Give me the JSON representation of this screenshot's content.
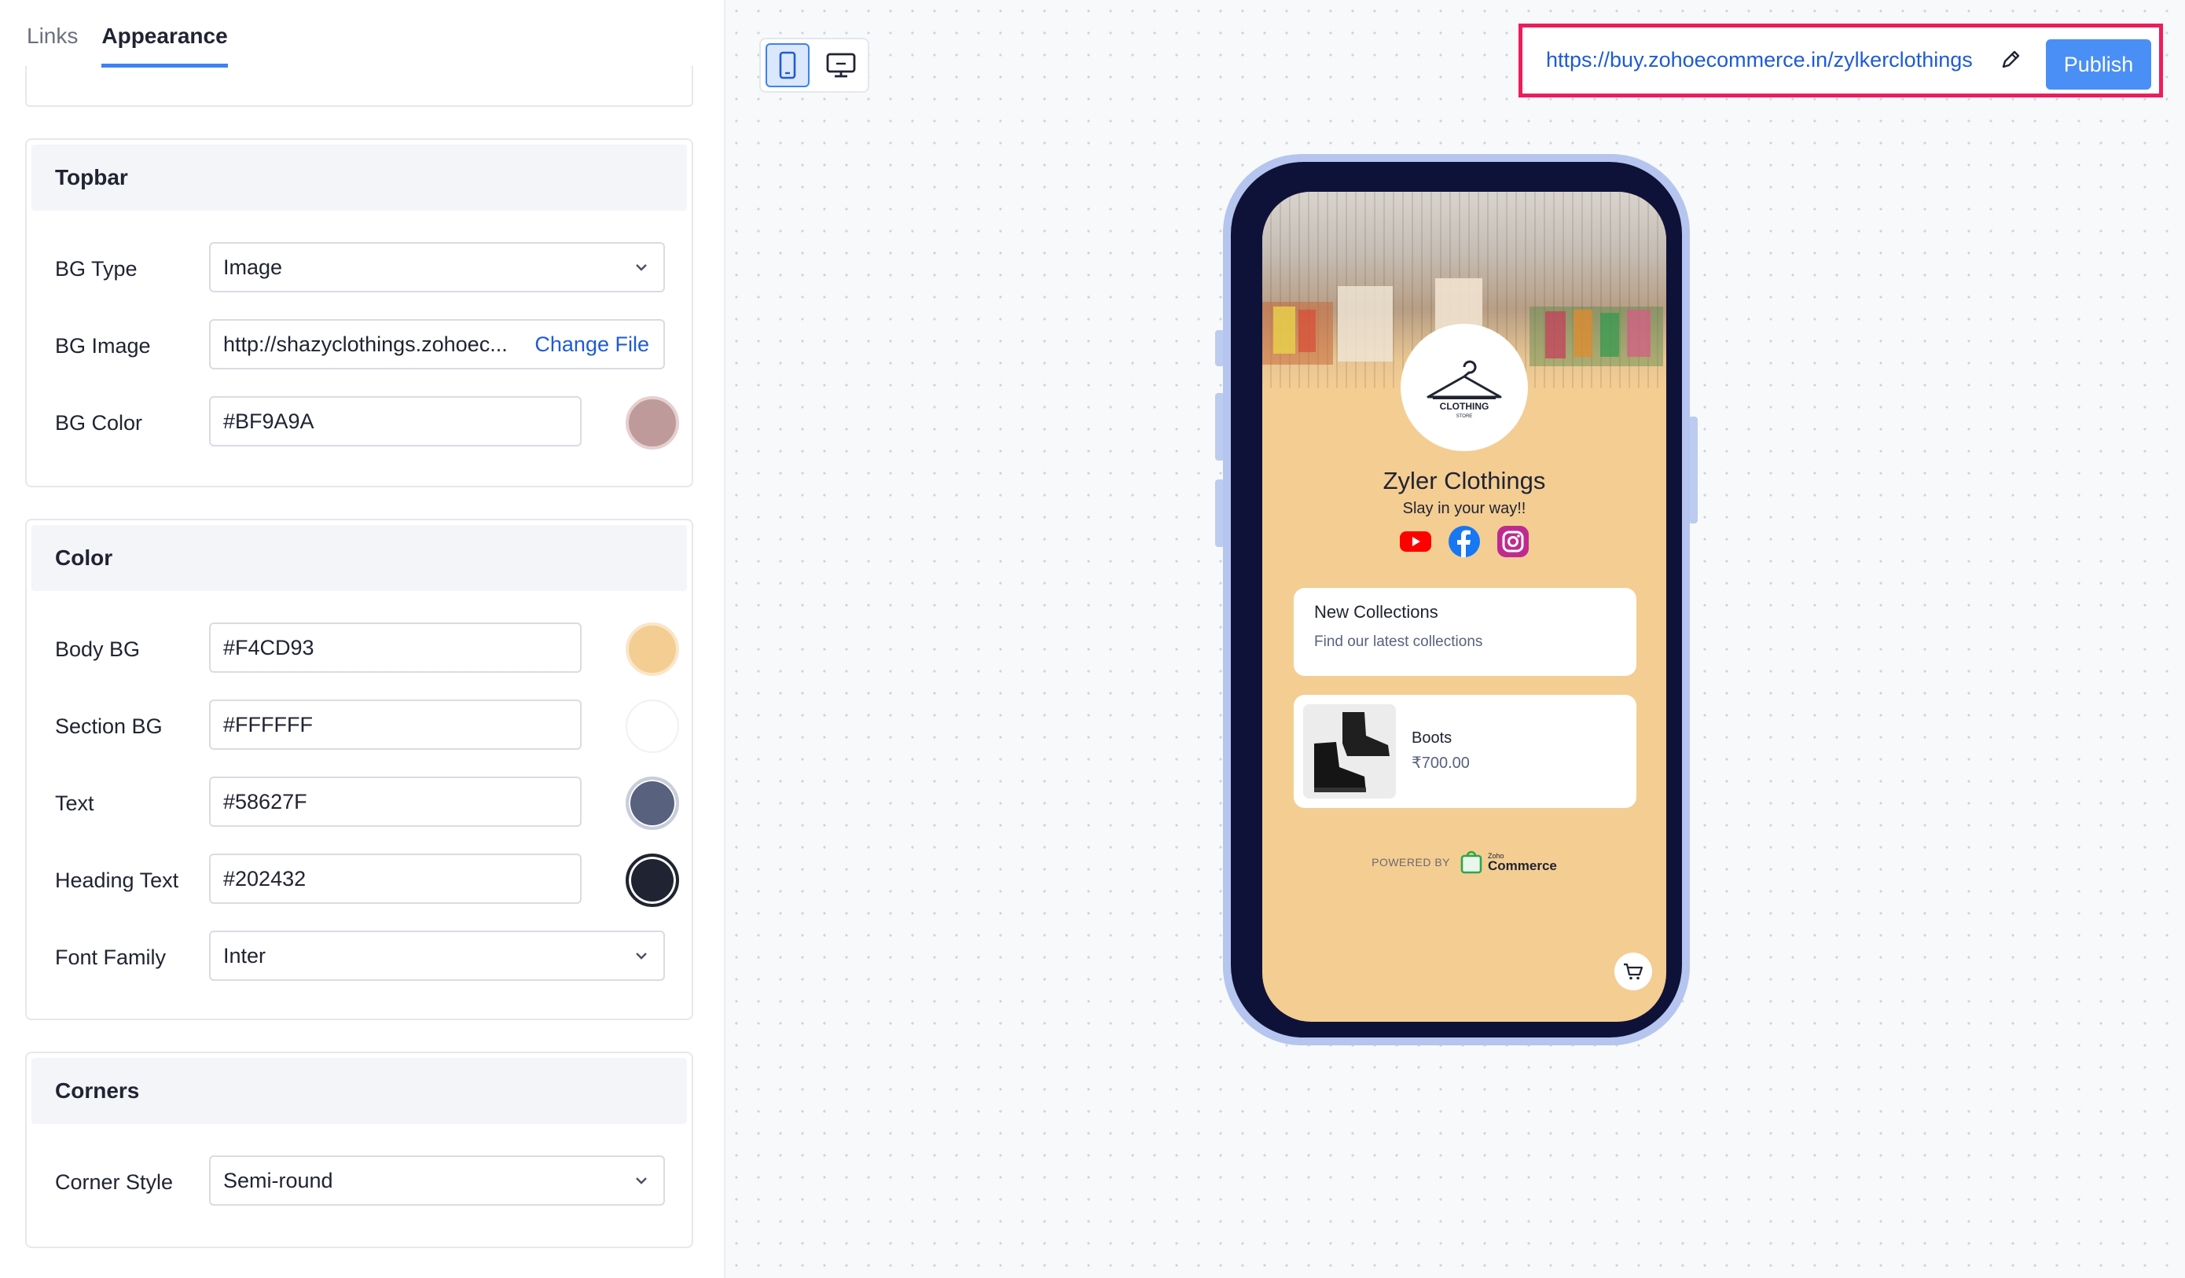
{
  "tabs": [
    {
      "label": "Links",
      "active": false
    },
    {
      "label": "Appearance",
      "active": true
    }
  ],
  "topbar": {
    "title": "Topbar",
    "bg_type_label": "BG Type",
    "bg_type_value": "Image",
    "bg_image_label": "BG Image",
    "bg_image_value": "http://shazyclothings.zohoec...",
    "change_file": "Change File",
    "bg_color_label": "BG Color",
    "bg_color_value": "#BF9A9A"
  },
  "color": {
    "title": "Color",
    "body_bg_label": "Body BG",
    "body_bg_value": "#F4CD93",
    "section_bg_label": "Section BG",
    "section_bg_value": "#FFFFFF",
    "text_label": "Text",
    "text_value": "#58627F",
    "heading_text_label": "Heading Text",
    "heading_text_value": "#202432",
    "font_family_label": "Font Family",
    "font_family_value": "Inter"
  },
  "corners": {
    "title": "Corners",
    "corner_style_label": "Corner Style",
    "corner_style_value": "Semi-round"
  },
  "toolbar": {
    "view_modes": [
      "mobile-icon",
      "desktop-icon"
    ],
    "active_view": "mobile",
    "url": "https://buy.zohoecommerce.in/zylkerclothings",
    "publish_label": "Publish",
    "accent_color": "#4a8ff5",
    "highlight_color": "#ee1d5a"
  },
  "preview": {
    "logo_text": "CLOTHING",
    "logo_subtext": "STORE",
    "store_name": "Zyler Clothings",
    "tagline": "Slay in your way!!",
    "socials": [
      "youtube-icon",
      "facebook-icon",
      "instagram-icon"
    ],
    "collection": {
      "title": "New Collections",
      "description": "Find our latest collections"
    },
    "product": {
      "name": "Boots",
      "price": "₹700.00"
    },
    "powered_by": "POWERED BY",
    "brand_small": "Zoho",
    "brand_word": "Commerce"
  }
}
